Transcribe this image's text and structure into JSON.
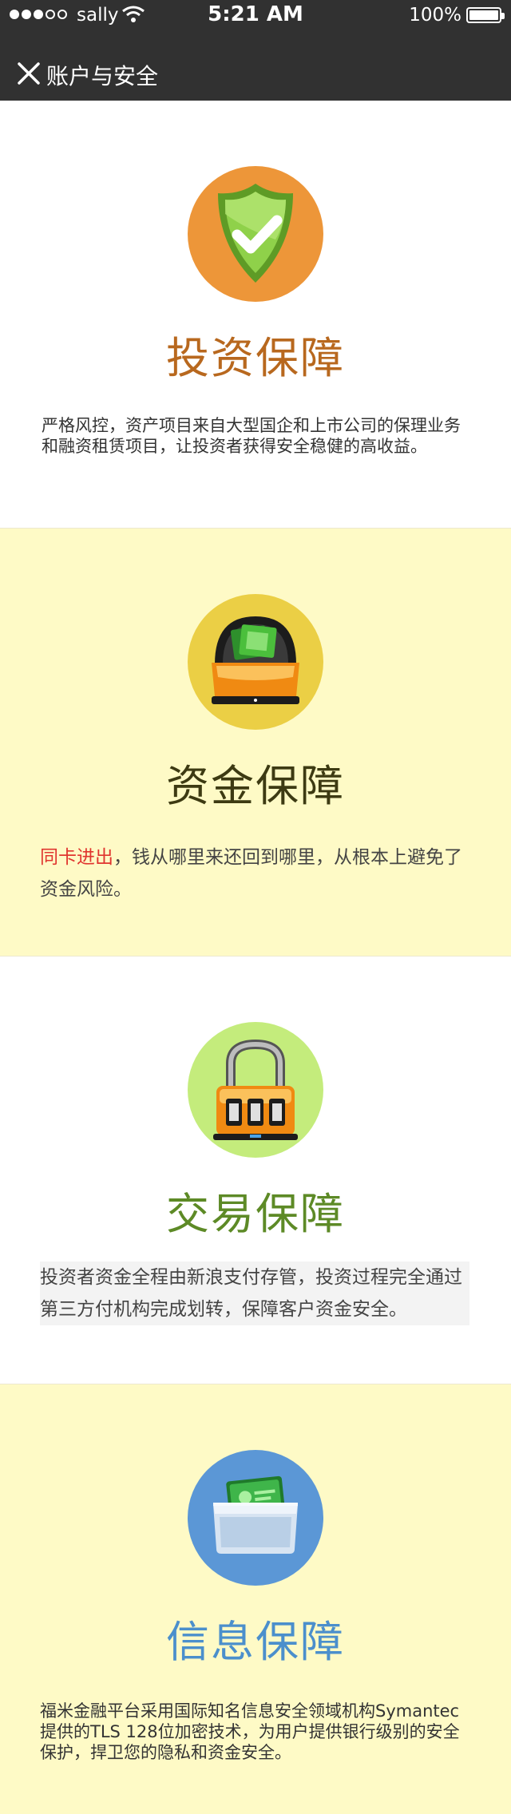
{
  "status_bar": {
    "carrier": "sally",
    "time": "5:21 AM",
    "battery": "100%"
  },
  "nav": {
    "title": "账户与安全"
  },
  "sections": [
    {
      "title": "投资保障",
      "title_color": "#b8681e",
      "badge_color": "#ed9639",
      "icon": "shield-check-icon",
      "text": "严格风控，资产项目来自大型国企和上市公司的保理业务和融资租赁项目，让投资者获得安全稳健的高收益。"
    },
    {
      "title": "资金保障",
      "title_color": "#3d3a12",
      "badge_color": "#ebcf45",
      "icon": "money-box-icon",
      "highlight": "同卡进出",
      "highlight_color": "#e0352f",
      "text": "，钱从哪里来还回到哪里，从根本上避免了资金风险。"
    },
    {
      "title": "交易保障",
      "title_color": "#5d8a26",
      "badge_color": "#c4ec7c",
      "icon": "combination-lock-icon",
      "text": "投资者资金全程由新浪支付存管，投资过程完全通过第三方付机构完成划转，保障客户资金安全。"
    },
    {
      "title": "信息保障",
      "title_color": "#4b8fcc",
      "badge_color": "#5b97d6",
      "icon": "wallet-icon",
      "text": "福米金融平台采用国际知名信息安全领域机构Symantec提供的TLS 128位加密技术，为用户提供银行级别的安全保护，捍卫您的隐私和资金安全。"
    }
  ]
}
